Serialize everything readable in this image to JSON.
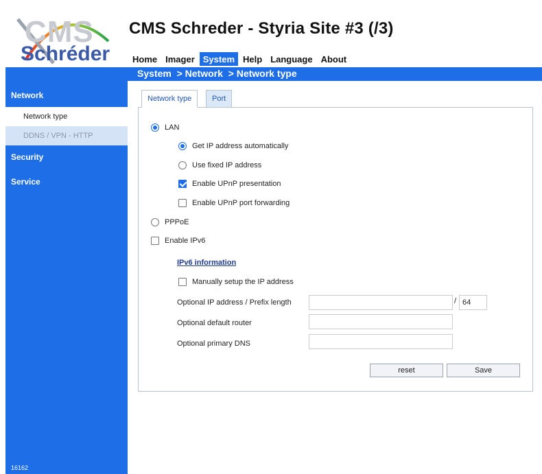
{
  "logo": {
    "cms_text": "CMS",
    "brand_text": "Schréder"
  },
  "app_title": "CMS Schreder - Styria Site #3 (/3)",
  "menu": {
    "items": [
      {
        "label": "Home"
      },
      {
        "label": "Imager"
      },
      {
        "label": "System"
      },
      {
        "label": "Help"
      },
      {
        "label": "Language"
      },
      {
        "label": "About"
      }
    ],
    "active": "System"
  },
  "breadcrumb": "System  > Network  > Network type",
  "sidebar": {
    "sections": [
      {
        "label": "Network"
      },
      {
        "label": "Security"
      },
      {
        "label": "Service"
      }
    ],
    "network_items": [
      {
        "label": "Network type",
        "selected": true
      },
      {
        "label": "DDNS / VPN - HTTP",
        "selected": false
      }
    ],
    "footer": "16162"
  },
  "tabs": [
    {
      "label": "Network type",
      "active": true
    },
    {
      "label": "Port",
      "active": false
    }
  ],
  "form": {
    "lan_label": "LAN",
    "lan_selected": true,
    "auto_ip_label": "Get IP address automatically",
    "auto_ip_selected": true,
    "fixed_ip_label": "Use fixed IP address",
    "fixed_ip_selected": false,
    "upnp_presentation_label": "Enable UPnP presentation",
    "upnp_presentation_checked": true,
    "upnp_forwarding_label": "Enable UPnP port forwarding",
    "upnp_forwarding_checked": false,
    "pppoe_label": "PPPoE",
    "pppoe_selected": false,
    "ipv6_label": "Enable IPv6",
    "ipv6_checked": false,
    "ipv6_info_label": "IPv6 information",
    "manual_ip_label": "Manually setup the IP address",
    "manual_ip_checked": false,
    "ip_prefix_label": "Optional IP address / Prefix length",
    "ip_value": "",
    "prefix_separator": "/",
    "prefix_value": "64",
    "router_label": "Optional default router",
    "router_value": "",
    "dns_label": "Optional primary DNS",
    "dns_value": "",
    "reset_label": "reset",
    "save_label": "Save"
  },
  "colors": {
    "accent": "#1e6ee8",
    "sidebar_selected_bg": "#ffffff",
    "sidebar_unselected_bg": "#d5e3f7"
  }
}
